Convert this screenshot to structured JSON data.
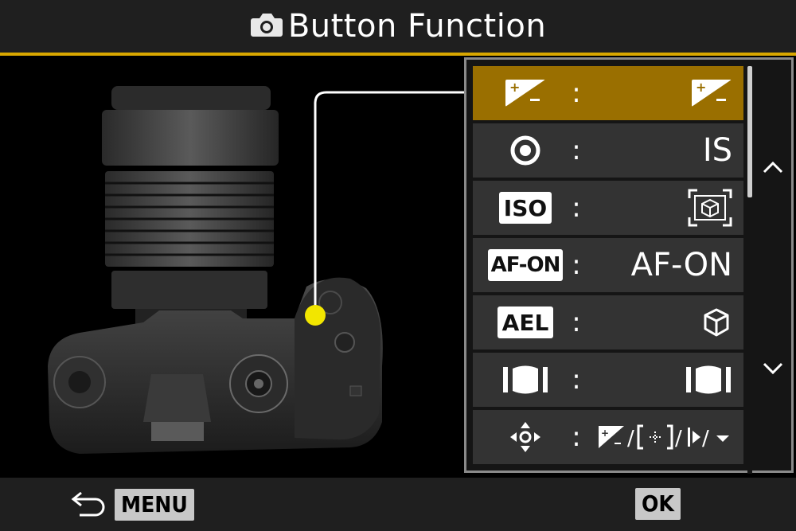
{
  "header": {
    "title": "Button Function",
    "icon": "camera-icon"
  },
  "rows": [
    {
      "icon": "exposure-compensation-icon",
      "value_text": "",
      "value_icon": "exposure-compensation-icon",
      "selected": true
    },
    {
      "icon": "circle-button-icon",
      "value_text": "IS",
      "value_icon": "",
      "selected": false
    },
    {
      "icon": "iso-button-icon",
      "icon_text": "ISO",
      "value_text": "",
      "value_icon": "subject-detection-frame-icon",
      "selected": false
    },
    {
      "icon": "af-on-button-icon",
      "icon_text": "AF-ON",
      "value_text": "AF-ON",
      "value_icon": "",
      "selected": false
    },
    {
      "icon": "ael-button-icon",
      "icon_text": "AEL",
      "value_text": "",
      "value_icon": "cube-icon",
      "selected": false
    },
    {
      "icon": "preview-button-icon",
      "value_text": "",
      "value_icon": "preview-icon",
      "selected": false
    },
    {
      "icon": "multi-selector-icon",
      "value_text": "",
      "value_icon": "exposure-af-area-combo-icon",
      "selected": false
    }
  ],
  "row_colon": ":",
  "footer": {
    "back_key": "MENU",
    "ok_key": "OK"
  },
  "colors": {
    "accent": "#d9a700",
    "selected_row": "#9a6f00",
    "callout_dot": "#f2e600"
  }
}
